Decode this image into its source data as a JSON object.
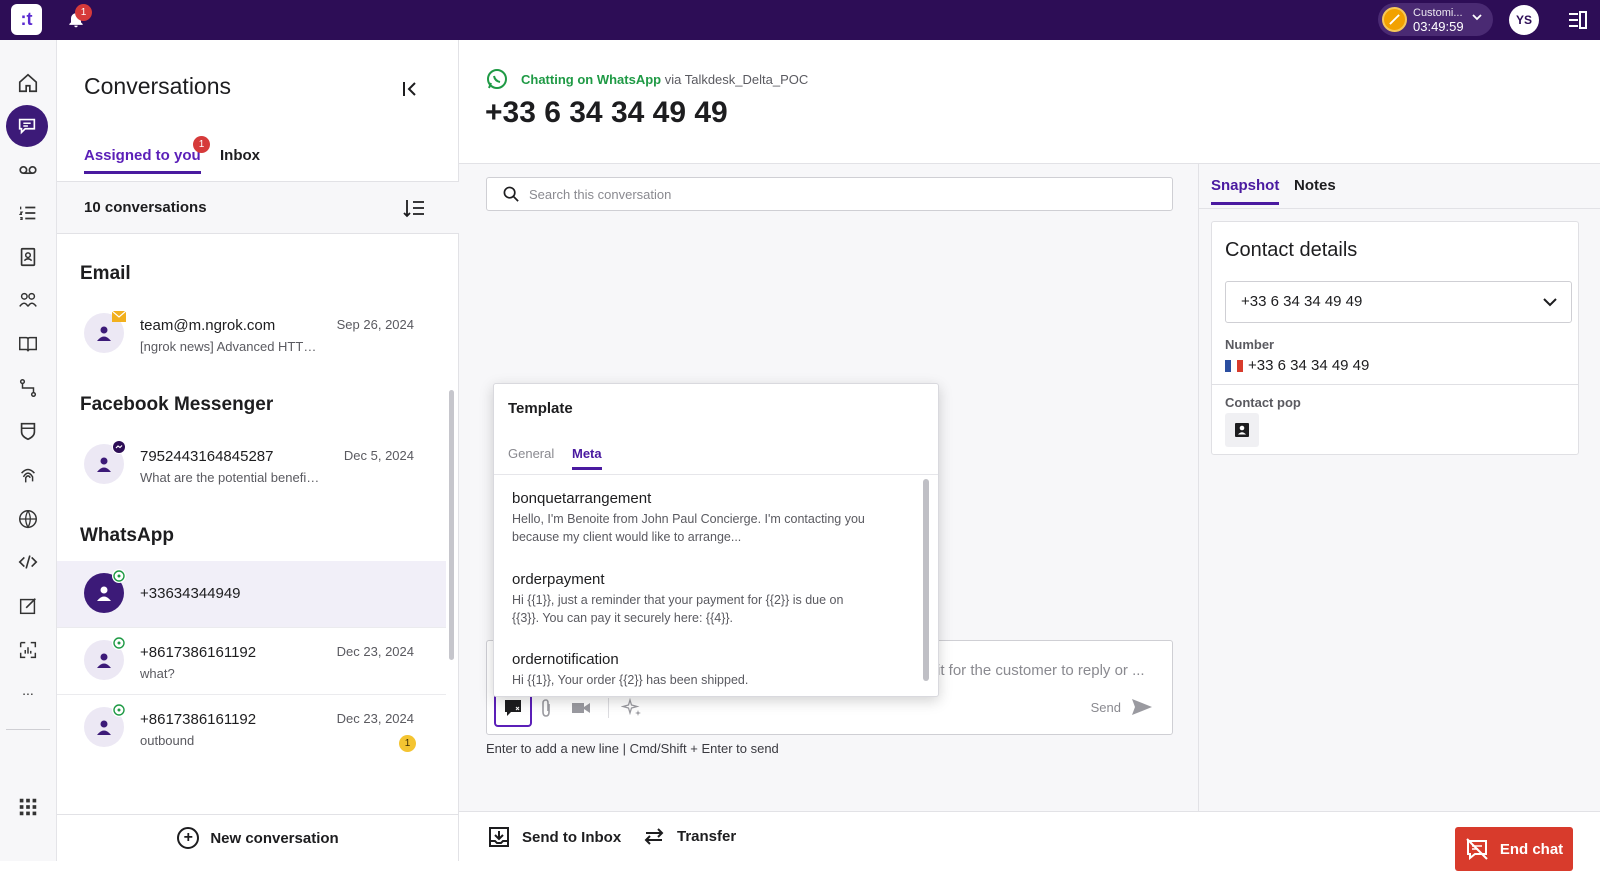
{
  "topbar": {
    "logo_text": ":t",
    "notifications_count": "1",
    "status_name": "Customi...",
    "status_timer": "03:49:59",
    "user_initials": "YS"
  },
  "nav": {
    "more_label": "..."
  },
  "conversations": {
    "title": "Conversations",
    "tab_assigned": "Assigned to you",
    "tab_assigned_badge": "1",
    "tab_inbox": "Inbox",
    "count_label": "10 conversations",
    "sections": {
      "email": "Email",
      "messenger": "Facebook Messenger",
      "whatsapp": "WhatsApp"
    },
    "items": [
      {
        "name": "team@m.ngrok.com",
        "preview": "[ngrok news] Advanced HTTP...",
        "date": "Sep 26, 2024"
      },
      {
        "name": "7952443164845287",
        "preview": "What are the potential benefits of...",
        "date": "Dec 5, 2024"
      },
      {
        "name": "+33634344949",
        "preview": "",
        "date": ""
      },
      {
        "name": "+8617386161192",
        "preview": "what?",
        "date": "Dec 23, 2024"
      },
      {
        "name": "+8617386161192",
        "preview": "outbound",
        "date": "Dec 23, 2024",
        "unread": "1"
      }
    ],
    "new_conversation": "New conversation"
  },
  "header": {
    "channel": "Chatting on WhatsApp",
    "via": "via Talkdesk_Delta_POC",
    "phone": "+33 6 34 34 49 49"
  },
  "chat": {
    "search_placeholder": "Search this conversation",
    "composer_placeholder": "it for the customer to reply or ...",
    "send_label": "Send",
    "hint": "Enter to add a new line | Cmd/Shift + Enter to send"
  },
  "template_popup": {
    "title": "Template",
    "tab_general": "General",
    "tab_meta": "Meta",
    "items": [
      {
        "name": "bonquetarrangement",
        "desc": "Hello, I'm Benoite from John Paul Concierge. I'm contacting you because my client would like to arrange..."
      },
      {
        "name": "orderpayment",
        "desc": "Hi {{1}}, just a reminder that your payment for {{2}} is due on {{3}}. You can pay it securely here: {{4}}."
      },
      {
        "name": "ordernotification",
        "desc": "Hi {{1}}, Your order {{2}} has been shipped."
      }
    ]
  },
  "right_panel": {
    "tab_snapshot": "Snapshot",
    "tab_notes": "Notes",
    "card_title": "Contact details",
    "selected_contact": "+33 6 34 34 49 49",
    "number_label": "Number",
    "number_value": "+33 6 34 34 49 49",
    "contact_pop_label": "Contact pop"
  },
  "footer": {
    "send_to_inbox": "Send to Inbox",
    "transfer": "Transfer",
    "end_chat": "End chat"
  },
  "colors": {
    "brand_dark": "#2d0d56",
    "accent_purple": "#4a1aa0",
    "end_chat_red": "#d83b2c",
    "whatsapp_green": "#1f9a45"
  }
}
